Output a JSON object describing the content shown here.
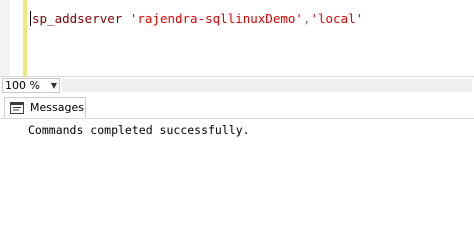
{
  "editor": {
    "procedure": "sp_addserver",
    "space": " ",
    "arg1": "'rajendra-sqllinuxDemo'",
    "separator": ",",
    "arg2": "'local'"
  },
  "zoom": {
    "value": "100 %"
  },
  "results": {
    "tab_label": "Messages",
    "message": "Commands completed successfully."
  },
  "icons": {
    "tab_icon": "messages-icon",
    "zoom_dropdown": "chevron-down-icon"
  },
  "colors": {
    "stored_procedure": "#800000",
    "string_literal": "#e00000",
    "punctuation": "#808080",
    "change_indicator": "#f2e678"
  }
}
